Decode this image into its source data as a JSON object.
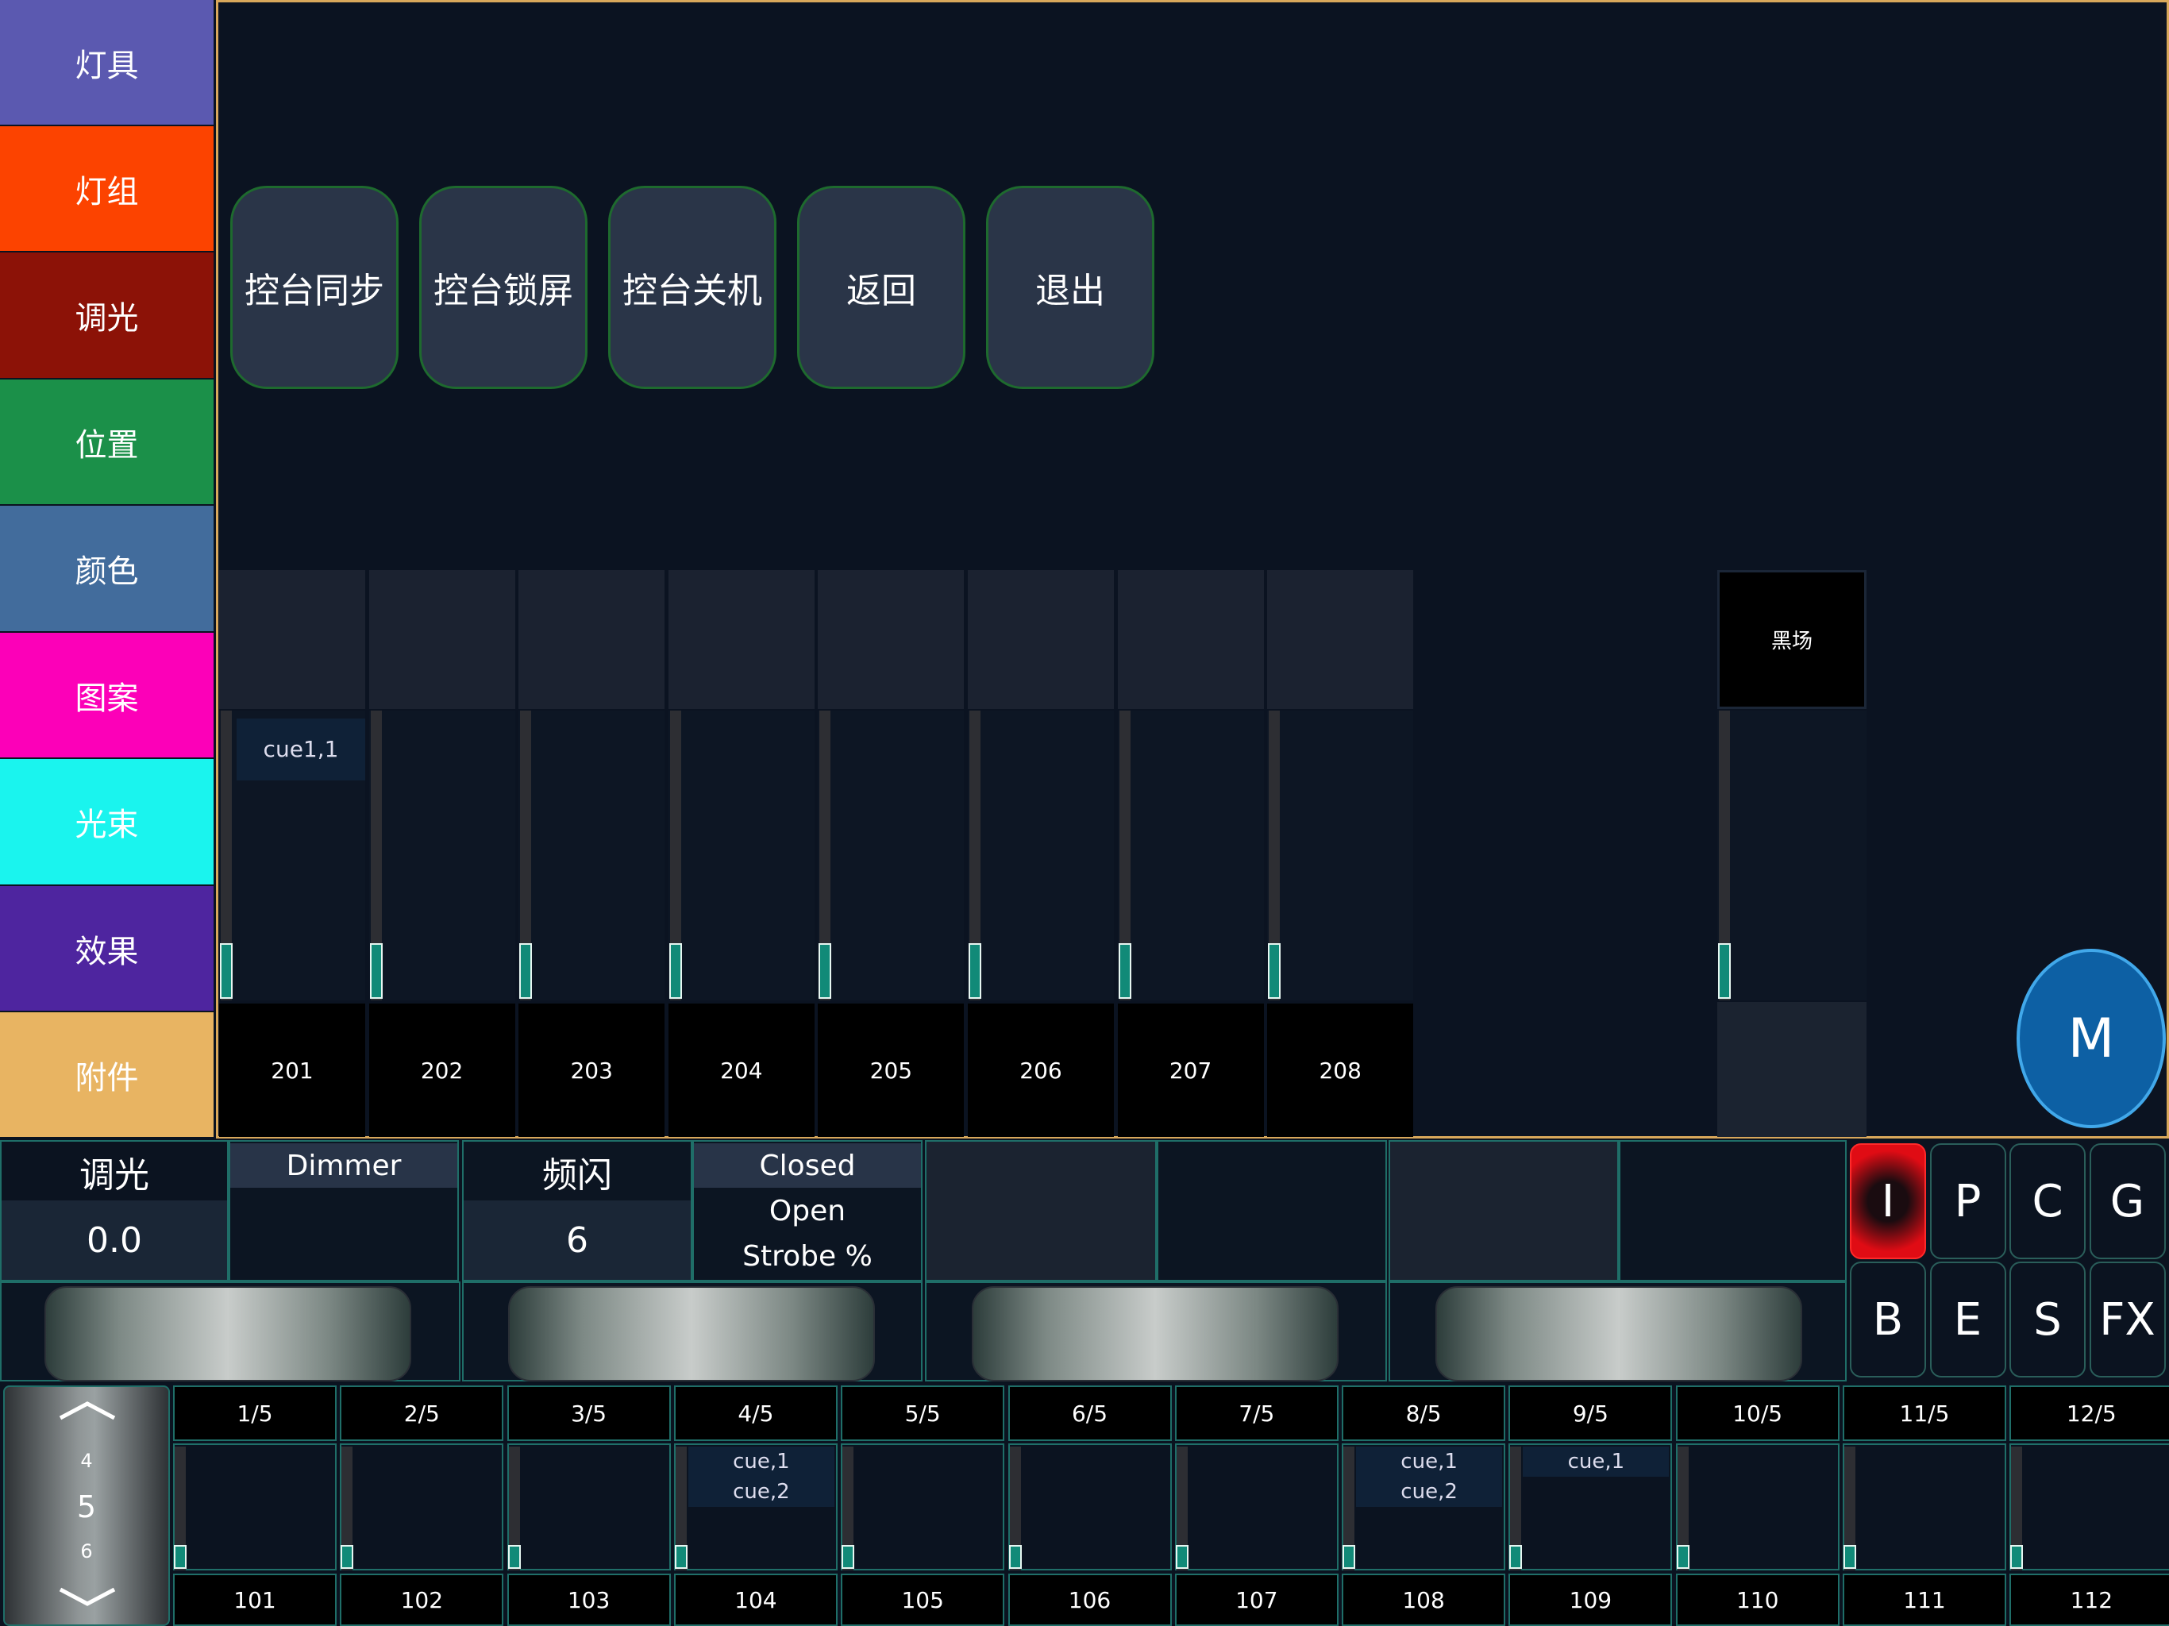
{
  "sidebar": {
    "items": [
      {
        "label": "灯具",
        "color": "#5b59b0"
      },
      {
        "label": "灯组",
        "color": "#fc4300"
      },
      {
        "label": "调光",
        "color": "#8c1207"
      },
      {
        "label": "位置",
        "color": "#1b9049"
      },
      {
        "label": "颜色",
        "color": "#426c9c"
      },
      {
        "label": "图案",
        "color": "#fc00b8"
      },
      {
        "label": "光束",
        "color": "#1af4ee"
      },
      {
        "label": "效果",
        "color": "#4e259f"
      },
      {
        "label": "附件",
        "color": "#e8b462"
      }
    ]
  },
  "main": {
    "buttons": [
      "控台同步",
      "控台锁屏",
      "控台关机",
      "返回",
      "退出"
    ],
    "faders": [
      {
        "label": "201",
        "cue": "cue1,1"
      },
      {
        "label": "202",
        "cue": ""
      },
      {
        "label": "203",
        "cue": ""
      },
      {
        "label": "204",
        "cue": ""
      },
      {
        "label": "205",
        "cue": ""
      },
      {
        "label": "206",
        "cue": ""
      },
      {
        "label": "207",
        "cue": ""
      },
      {
        "label": "208",
        "cue": ""
      }
    ],
    "blackout": {
      "label": "黑场"
    },
    "m_button": "M"
  },
  "params": {
    "p1": {
      "name": "调光",
      "value": "0.0",
      "attr": "Dimmer"
    },
    "p2": {
      "name": "频闪",
      "value": "6",
      "options": [
        "Closed",
        "Open",
        "Strobe %"
      ]
    }
  },
  "keys": [
    "I",
    "P",
    "C",
    "G",
    "B",
    "E",
    "S",
    "FX"
  ],
  "keys_active": "I",
  "pager": {
    "prev": "4",
    "current": "5",
    "next": "6"
  },
  "pages": [
    "1/5",
    "2/5",
    "3/5",
    "4/5",
    "5/5",
    "6/5",
    "7/5",
    "8/5",
    "9/5",
    "10/5",
    "11/5",
    "12/5"
  ],
  "bottom_faders": [
    {
      "label": "101",
      "cues": []
    },
    {
      "label": "102",
      "cues": []
    },
    {
      "label": "103",
      "cues": []
    },
    {
      "label": "104",
      "cues": [
        "cue,1",
        "cue,2"
      ]
    },
    {
      "label": "105",
      "cues": []
    },
    {
      "label": "106",
      "cues": []
    },
    {
      "label": "107",
      "cues": []
    },
    {
      "label": "108",
      "cues": [
        "cue,1",
        "cue,2"
      ]
    },
    {
      "label": "109",
      "cues": [
        "cue,1"
      ]
    },
    {
      "label": "110",
      "cues": []
    },
    {
      "label": "111",
      "cues": []
    },
    {
      "label": "112",
      "cues": []
    }
  ]
}
